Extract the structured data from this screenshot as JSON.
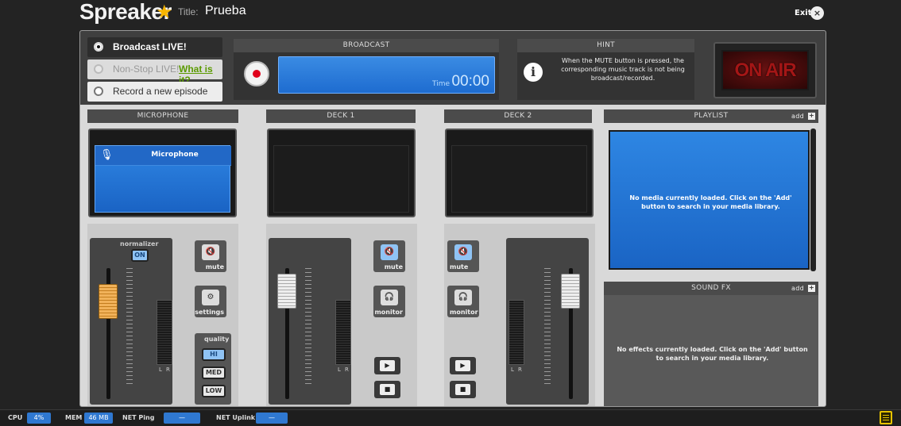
{
  "app": {
    "logo": "Spreaker",
    "title_label": "Title:",
    "title_value": "Prueba",
    "exit_label": "Exit",
    "exit_icon": "close-icon"
  },
  "modes": {
    "broadcast_live": "Broadcast LIVE!",
    "nonstop_live": "Non-Stop LIVE!",
    "nonstop_link": "What is it?",
    "record_episode": "Record a new episode",
    "selected": "Broadcast LIVE!"
  },
  "broadcast": {
    "header": "BROADCAST",
    "time_label": "Time",
    "time_value": "00:00"
  },
  "hint": {
    "header": "HINT",
    "text": "When the MUTE button is pressed, the corresponding music track is not being broadcast/recorded."
  },
  "onair": {
    "label": "ON AIR"
  },
  "microphone": {
    "header": "MICROPHONE",
    "screen_title": "Microphone",
    "normalizer_label": "normalizer",
    "normalizer_value": "ON",
    "mute_label": "mute",
    "settings_label": "settings",
    "quality_label": "quality",
    "quality_options": [
      "HI",
      "MED",
      "LOW"
    ],
    "quality_selected": "HI",
    "vu_l": "L",
    "vu_r": "R"
  },
  "deck1": {
    "header": "DECK 1",
    "mute_label": "mute",
    "monitor_label": "monitor",
    "vu_l": "L",
    "vu_r": "R"
  },
  "deck2": {
    "header": "DECK 2",
    "mute_label": "mute",
    "monitor_label": "monitor",
    "vu_l": "L",
    "vu_r": "R"
  },
  "playlist": {
    "header": "PLAYLIST",
    "add_label": "add",
    "empty_message": "No media currently loaded. Click on the 'Add' button to search in your media library."
  },
  "sound_fx": {
    "header": "SOUND FX",
    "add_label": "add",
    "empty_message": "No effects currently loaded. Click on the 'Add' button to search in your media library."
  },
  "status": {
    "cpu_label": "CPU",
    "cpu_value": "4%",
    "mem_label": "MEM",
    "mem_value": "46 MB",
    "net_ping_label": "NET Ping",
    "net_ping_value": "—",
    "net_uplink_label": "NET Uplink",
    "net_uplink_value": "—"
  },
  "colors": {
    "accent_blue": "#2f78d1",
    "record_red": "#e0001b",
    "logo_star": "#f7b500",
    "link_green": "#5a9a00"
  }
}
